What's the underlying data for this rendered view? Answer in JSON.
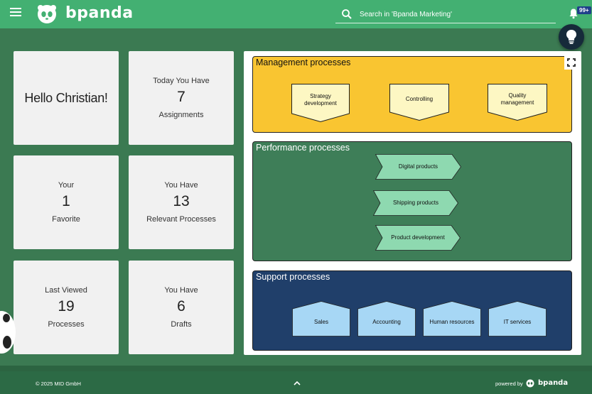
{
  "header": {
    "brand": "bpanda",
    "search_placeholder": "Search in 'Bpanda Marketing'",
    "notification_count": "99+"
  },
  "tiles": {
    "greeting": "Hello Christian!",
    "assignments": {
      "top": "Today You Have",
      "value": "7",
      "bottom": "Assignments"
    },
    "favorite": {
      "top": "Your",
      "value": "1",
      "bottom": "Favorite"
    },
    "relevant": {
      "top": "You Have",
      "value": "13",
      "bottom": "Relevant Processes"
    },
    "last_viewed": {
      "top": "Last Viewed",
      "value": "19",
      "bottom": "Processes"
    },
    "drafts": {
      "top": "You Have",
      "value": "6",
      "bottom": "Drafts"
    }
  },
  "process_map": {
    "management": {
      "title": "Management processes",
      "color": "#f9c531",
      "items": [
        "Strategy\ndevelopment",
        "Controlling",
        "Quality\nmanagement"
      ]
    },
    "performance": {
      "title": "Performance processes",
      "color": "#3e7e58",
      "items": [
        "Digital products",
        "Shipping products",
        "Product development"
      ]
    },
    "support": {
      "title": "Support processes",
      "color": "#203f6a",
      "items": [
        "Sales",
        "Accounting",
        "Human resources",
        "IT services"
      ]
    }
  },
  "footer": {
    "copyright": "© 2025 MID GmbH",
    "powered_by": "powered by",
    "brand": "bpanda"
  },
  "colors": {
    "header": "#43b072",
    "background": "#3b7a52",
    "footer": "#2c6a45",
    "badge": "#1f3f8a",
    "shape_light_green": "#8ed9b0",
    "shape_light_yellow": "#fdf7c3",
    "shape_light_blue": "#a7d7f5"
  }
}
